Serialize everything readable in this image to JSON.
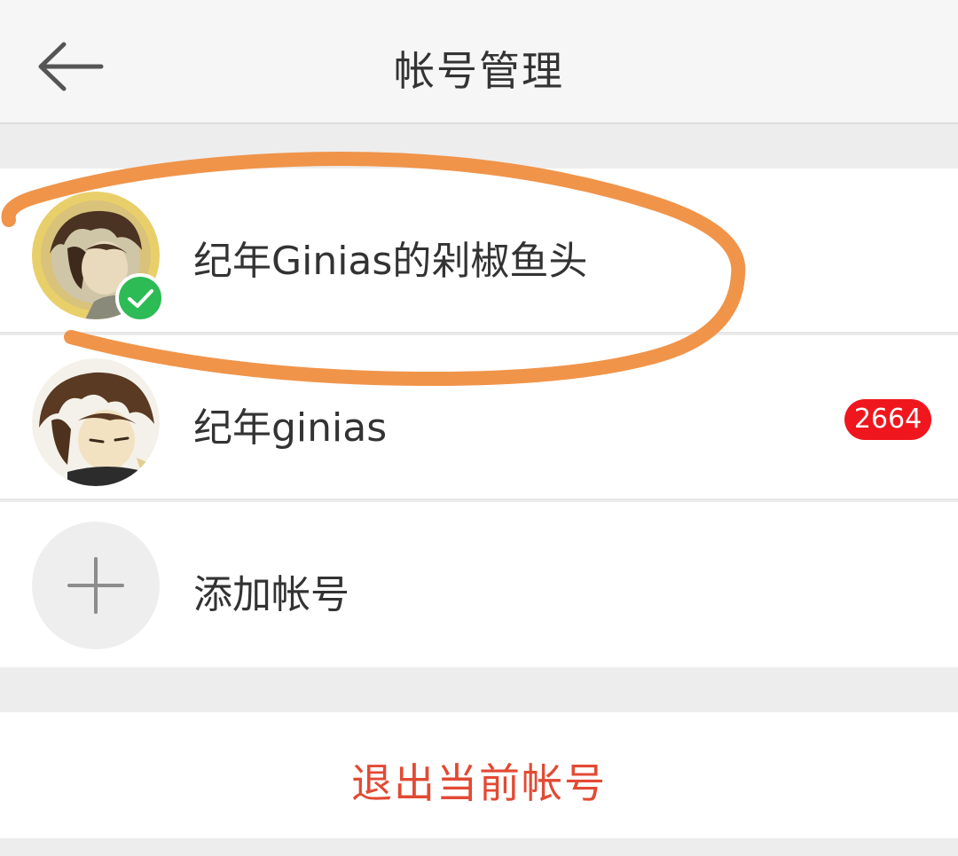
{
  "header": {
    "title": "帐号管理",
    "back_icon": "arrow-left-icon"
  },
  "accounts": [
    {
      "name": "纪年Ginias的剁椒鱼头",
      "current": true,
      "status_icon": "check-icon",
      "status_color": "#2dbb55"
    },
    {
      "name": "纪年ginias",
      "current": false,
      "unread_count": "2664",
      "badge_color": "#f0161e"
    }
  ],
  "add_account": {
    "label": "添加帐号",
    "icon": "plus-icon"
  },
  "logout": {
    "label": "退出当前帐号",
    "color": "#e24a33"
  },
  "annotation": {
    "color": "#f0944a",
    "shape": "hand-drawn oval"
  }
}
